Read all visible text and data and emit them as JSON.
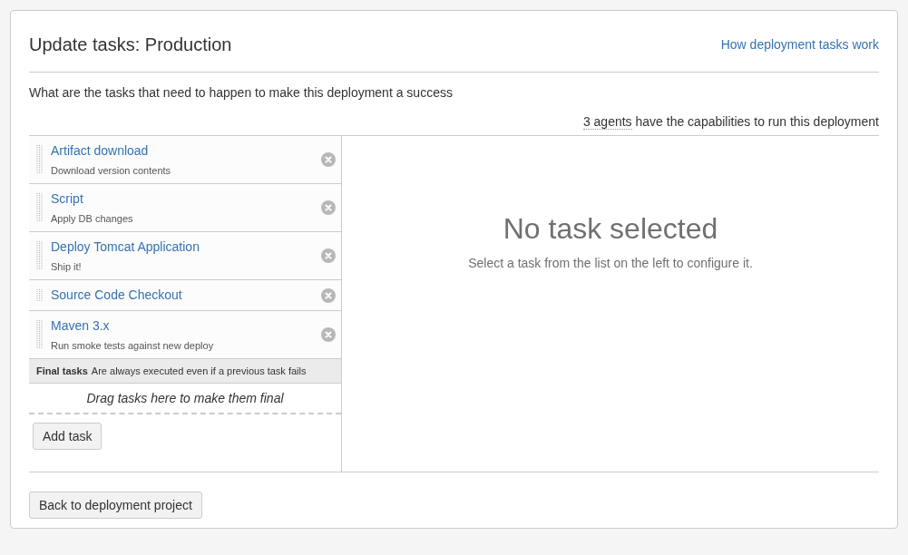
{
  "title": "Update tasks: Production",
  "help_link": "How deployment tasks work",
  "description": "What are the tasks that need to happen to make this deployment a success",
  "agents": {
    "link": "3 agents",
    "text": "have the capabilities to run this deployment"
  },
  "tasks": [
    {
      "name": "Artifact download",
      "description": "Download version contents"
    },
    {
      "name": "Script",
      "description": "Apply DB changes"
    },
    {
      "name": "Deploy Tomcat Application",
      "description": "Ship it!"
    },
    {
      "name": "Source Code Checkout"
    },
    {
      "name": "Maven 3.x",
      "description": "Run smoke tests against new deploy"
    }
  ],
  "final_tasks": {
    "label": "Final tasks",
    "note": "Are always executed even if a previous task fails",
    "drop_hint": "Drag tasks here to make them final"
  },
  "add_button": "Add task",
  "empty_state": {
    "title": "No task selected",
    "hint": "Select a task from the list on the left to configure it."
  },
  "back_button": "Back to deployment project"
}
